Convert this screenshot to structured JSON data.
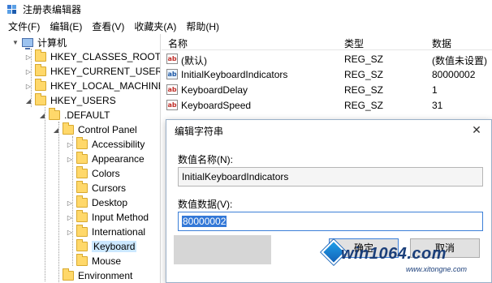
{
  "window": {
    "title": "注册表编辑器",
    "icon": "regedit-icon"
  },
  "menu": [
    "文件(F)",
    "编辑(E)",
    "查看(V)",
    "收藏夹(A)",
    "帮助(H)"
  ],
  "tree": {
    "root": "计算机",
    "hives": [
      "HKEY_CLASSES_ROOT",
      "HKEY_CURRENT_USER",
      "HKEY_LOCAL_MACHINE",
      "HKEY_USERS"
    ],
    "default_key": ".DEFAULT",
    "control_panel": "Control Panel",
    "children": [
      "Accessibility",
      "Appearance",
      "Colors",
      "Cursors",
      "Desktop",
      "Input Method",
      "International",
      "Keyboard",
      "Mouse"
    ],
    "environment": "Environment",
    "selected": "Keyboard"
  },
  "list": {
    "headers": {
      "name": "名称",
      "type": "类型",
      "data": "数据"
    },
    "rows": [
      {
        "icon": "string-value-icon",
        "name": "(默认)",
        "type": "REG_SZ",
        "data": "(数值未设置)"
      },
      {
        "icon": "binary-value-icon",
        "name": "InitialKeyboardIndicators",
        "type": "REG_SZ",
        "data": "80000002"
      },
      {
        "icon": "string-value-icon",
        "name": "KeyboardDelay",
        "type": "REG_SZ",
        "data": "1"
      },
      {
        "icon": "string-value-icon",
        "name": "KeyboardSpeed",
        "type": "REG_SZ",
        "data": "31"
      }
    ]
  },
  "dialog": {
    "title": "编辑字符串",
    "name_label": "数值名称(N):",
    "name_value": "InitialKeyboardIndicators",
    "data_label": "数值数据(V):",
    "data_value": "80000002",
    "ok_label": "确定",
    "cancel_label": "取消"
  },
  "watermark": {
    "text": "win1064.com",
    "sub": "www.xitongne.com"
  },
  "colors": {
    "selection": "#3378d7",
    "tree_selected": "#cce8ff",
    "folder": "#ffd86a",
    "focus_border": "#3c7fd8"
  }
}
